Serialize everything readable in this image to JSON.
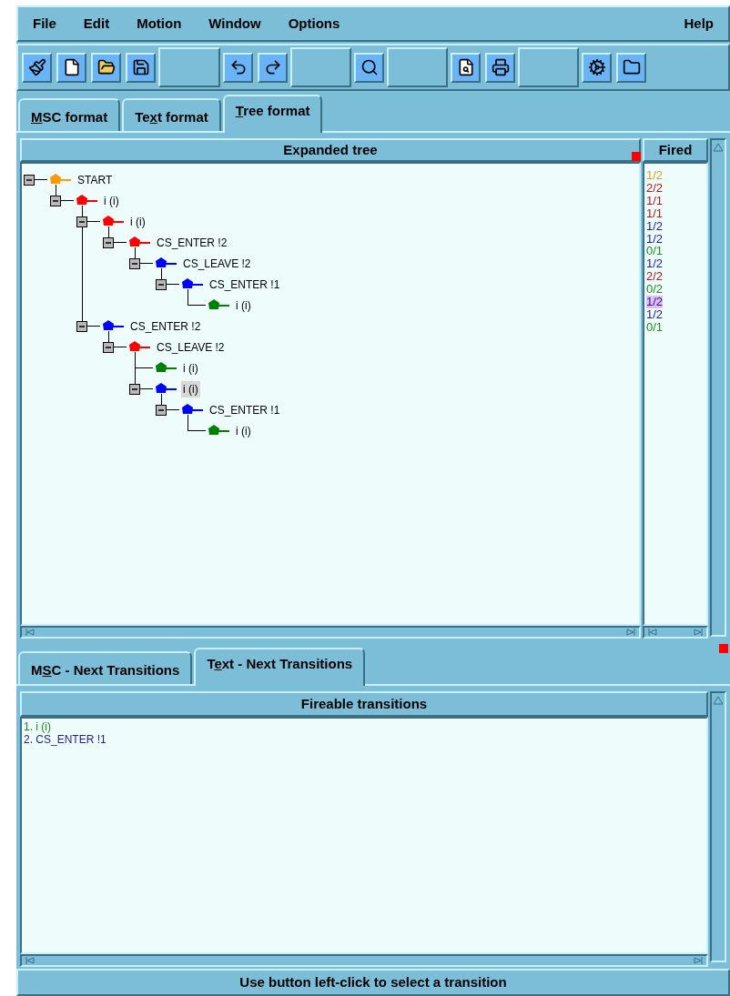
{
  "menu": {
    "left": [
      "File",
      "Edit",
      "Motion",
      "Window",
      "Options"
    ],
    "right": "Help"
  },
  "tabs": [
    {
      "key": "M",
      "post": "SC format",
      "selected": false
    },
    {
      "pre": "Te",
      "key": "x",
      "post": "t format",
      "selected": false
    },
    {
      "key": "T",
      "post": "ree format",
      "selected": true
    }
  ],
  "tree_panel": {
    "header": "Expanded tree",
    "fired_header": "Fired",
    "tree": [
      {
        "label": "START",
        "color": "#ff9900",
        "expanded": true,
        "selected": false,
        "children": [
          {
            "label": "i (i)",
            "color": "#ff0000",
            "expanded": true,
            "selected": false,
            "children": [
              {
                "label": "i (i)",
                "color": "#ff0000",
                "expanded": true,
                "selected": false,
                "children": [
                  {
                    "label": "CS_ENTER !2",
                    "color": "#ff0000",
                    "expanded": true,
                    "selected": false,
                    "children": [
                      {
                        "label": "CS_LEAVE !2",
                        "color": "#0000ff",
                        "expanded": true,
                        "selected": false,
                        "children": [
                          {
                            "label": "CS_ENTER !1",
                            "color": "#0000ff",
                            "expanded": true,
                            "selected": false,
                            "children": [
                              {
                                "label": "i (i)",
                                "color": "#008000",
                                "selected": false
                              }
                            ]
                          }
                        ]
                      }
                    ]
                  }
                ]
              },
              {
                "label": "CS_ENTER !2",
                "color": "#0000ff",
                "expanded": true,
                "selected": false,
                "children": [
                  {
                    "label": "CS_LEAVE !2",
                    "color": "#ff0000",
                    "expanded": true,
                    "selected": false,
                    "children": [
                      {
                        "label": "i (i)",
                        "color": "#008000",
                        "selected": false
                      },
                      {
                        "label": "i (i)",
                        "color": "#0000ff",
                        "expanded": true,
                        "selected": true,
                        "children": [
                          {
                            "label": "CS_ENTER !1",
                            "color": "#0000ff",
                            "expanded": true,
                            "selected": false,
                            "children": [
                              {
                                "label": "i (i)",
                                "color": "#008000",
                                "selected": false
                              }
                            ]
                          }
                        ]
                      }
                    ]
                  }
                ]
              }
            ]
          }
        ]
      }
    ],
    "fired": [
      {
        "text": "1/2",
        "color": "#d4a21c",
        "selected": false
      },
      {
        "text": "2/2",
        "color": "#b01818",
        "selected": false
      },
      {
        "text": "1/1",
        "color": "#b01818",
        "selected": false
      },
      {
        "text": "1/1",
        "color": "#b01818",
        "selected": false
      },
      {
        "text": "1/2",
        "color": "#1c1c9c",
        "selected": false
      },
      {
        "text": "1/2",
        "color": "#1c1c9c",
        "selected": false
      },
      {
        "text": "0/1",
        "color": "#1c8c1c",
        "selected": false
      },
      {
        "text": "1/2",
        "color": "#1c1c9c",
        "selected": false
      },
      {
        "text": "2/2",
        "color": "#b01818",
        "selected": false
      },
      {
        "text": "0/2",
        "color": "#1c8c1c",
        "selected": false
      },
      {
        "text": "1/2",
        "color": "#1c1c9c",
        "selected": true
      },
      {
        "text": "1/2",
        "color": "#1c1c9c",
        "selected": false
      },
      {
        "text": "0/1",
        "color": "#1c8c1c",
        "selected": false
      }
    ]
  },
  "bottom_tabs": [
    {
      "pre": "M",
      "key": "S",
      "post": "C - Next Transitions",
      "selected": false
    },
    {
      "pre": "T",
      "key": "e",
      "post": "xt - Next Transitions",
      "selected": true
    }
  ],
  "transitions_panel": {
    "header": "Fireable transitions",
    "items": [
      {
        "text": "1. i (i)",
        "color": "#1c8c1c"
      },
      {
        "text": "2. CS_ENTER !1",
        "color": "#1c1c9c"
      }
    ]
  },
  "status_bar": "Use button left-click to select a transition"
}
